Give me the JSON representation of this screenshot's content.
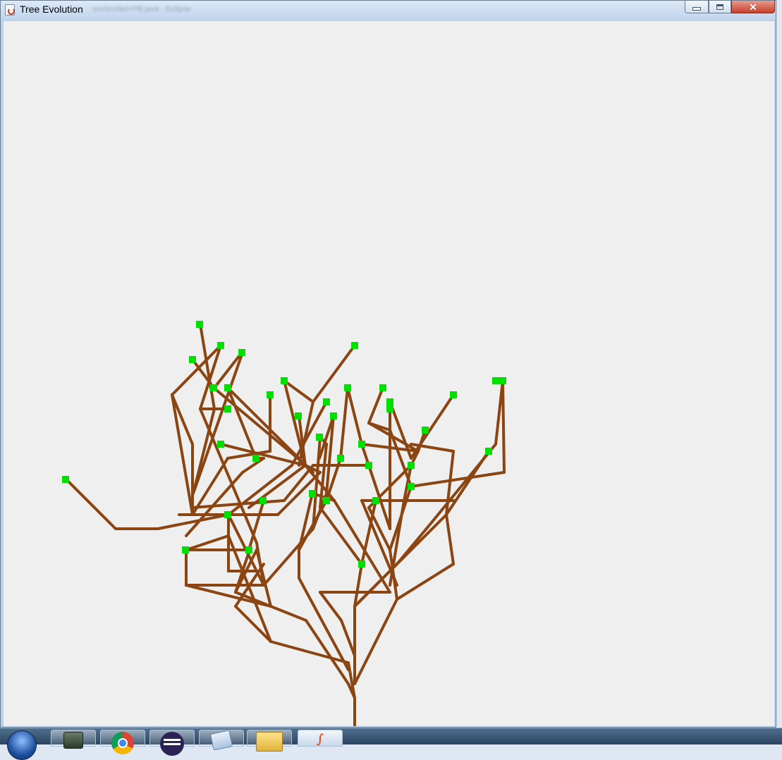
{
  "window": {
    "title": "Tree Evolution",
    "background_title": "src/src/del+PB.java - Eclipse",
    "controls": {
      "minimize": "minimize",
      "maximize": "maximize",
      "close": "✕"
    }
  },
  "colors": {
    "canvas_bg": "#efefef",
    "branch": "#8b4513",
    "leaf": "#00e000"
  },
  "tree": {
    "branches": [
      [
        502,
        1029,
        502,
        989
      ],
      [
        502,
        989,
        493,
        969
      ],
      [
        493,
        969,
        433,
        879
      ],
      [
        433,
        879,
        383,
        859
      ],
      [
        383,
        859,
        333,
        839
      ],
      [
        333,
        839,
        353,
        779
      ],
      [
        502,
        989,
        493,
        939
      ],
      [
        493,
        939,
        383,
        909
      ],
      [
        383,
        909,
        333,
        859
      ],
      [
        333,
        859,
        373,
        799
      ],
      [
        502,
        969,
        562,
        849
      ],
      [
        562,
        849,
        552,
        779
      ],
      [
        552,
        779,
        582,
        689
      ],
      [
        562,
        849,
        642,
        799
      ],
      [
        642,
        799,
        632,
        729
      ],
      [
        632,
        729,
        692,
        639
      ],
      [
        632,
        729,
        642,
        639
      ],
      [
        642,
        639,
        582,
        629
      ],
      [
        502,
        969,
        502,
        859
      ],
      [
        502,
        859,
        562,
        799
      ],
      [
        562,
        799,
        612,
        739
      ],
      [
        612,
        739,
        702,
        629
      ],
      [
        702,
        629,
        712,
        539
      ],
      [
        712,
        539,
        714,
        669
      ],
      [
        714,
        669,
        582,
        689
      ],
      [
        502,
        859,
        512,
        799
      ],
      [
        512,
        799,
        532,
        709
      ],
      [
        502,
        929,
        483,
        879
      ],
      [
        483,
        879,
        453,
        839
      ],
      [
        453,
        839,
        552,
        839
      ],
      [
        552,
        839,
        473,
        709
      ],
      [
        473,
        709,
        443,
        699
      ],
      [
        493,
        949,
        423,
        819
      ],
      [
        423,
        819,
        423,
        779
      ],
      [
        423,
        779,
        462,
        709
      ],
      [
        462,
        709,
        482,
        649
      ],
      [
        482,
        649,
        492,
        549
      ],
      [
        423,
        779,
        442,
        699
      ],
      [
        383,
        859,
        263,
        829
      ],
      [
        263,
        829,
        263,
        779
      ],
      [
        263,
        779,
        352,
        779
      ],
      [
        352,
        779,
        373,
        709
      ],
      [
        263,
        829,
        373,
        829
      ],
      [
        373,
        829,
        323,
        729
      ],
      [
        323,
        729,
        323,
        809
      ],
      [
        323,
        809,
        363,
        809
      ],
      [
        373,
        829,
        443,
        749
      ],
      [
        443,
        749,
        462,
        699
      ],
      [
        462,
        699,
        472,
        589
      ],
      [
        443,
        749,
        453,
        619
      ],
      [
        333,
        839,
        363,
        779
      ],
      [
        363,
        779,
        383,
        859
      ],
      [
        383,
        909,
        323,
        759
      ],
      [
        323,
        759,
        263,
        779
      ],
      [
        373,
        829,
        363,
        769
      ],
      [
        363,
        769,
        283,
        579
      ],
      [
        283,
        579,
        323,
        579
      ],
      [
        283,
        579,
        312,
        489
      ],
      [
        243,
        559,
        272,
        629
      ],
      [
        272,
        629,
        272,
        729
      ],
      [
        272,
        729,
        243,
        559
      ],
      [
        243,
        559,
        312,
        489
      ],
      [
        272,
        729,
        322,
        649
      ],
      [
        322,
        649,
        382,
        639
      ],
      [
        382,
        639,
        382,
        559
      ],
      [
        272,
        719,
        402,
        709
      ],
      [
        402,
        709,
        443,
        659
      ],
      [
        443,
        659,
        522,
        659
      ],
      [
        253,
        729,
        393,
        729
      ],
      [
        393,
        729,
        453,
        669
      ],
      [
        453,
        669,
        432,
        659
      ],
      [
        432,
        659,
        402,
        539
      ],
      [
        223,
        749,
        163,
        749
      ],
      [
        163,
        749,
        93,
        679
      ],
      [
        223,
        749,
        323,
        729
      ],
      [
        323,
        729,
        413,
        659
      ],
      [
        413,
        659,
        462,
        569
      ],
      [
        263,
        759,
        343,
        669
      ],
      [
        343,
        669,
        373,
        649
      ],
      [
        373,
        649,
        362,
        649
      ],
      [
        432,
        659,
        312,
        629
      ],
      [
        432,
        659,
        352,
        719
      ],
      [
        433,
        659,
        302,
        549
      ],
      [
        302,
        549,
        272,
        509
      ],
      [
        443,
        669,
        322,
        549
      ],
      [
        473,
        709,
        432,
        659
      ],
      [
        432,
        659,
        423,
        589
      ],
      [
        423,
        659,
        443,
        569
      ],
      [
        443,
        569,
        502,
        489
      ],
      [
        443,
        569,
        402,
        539
      ],
      [
        512,
        799,
        453,
        719
      ],
      [
        453,
        719,
        462,
        629
      ],
      [
        462,
        629,
        453,
        619
      ],
      [
        552,
        779,
        522,
        719
      ],
      [
        522,
        719,
        582,
        659
      ],
      [
        582,
        659,
        592,
        639
      ],
      [
        592,
        639,
        602,
        609
      ],
      [
        582,
        689,
        552,
        609
      ],
      [
        552,
        609,
        522,
        599
      ],
      [
        522,
        599,
        542,
        549
      ],
      [
        562,
        829,
        512,
        709
      ],
      [
        512,
        709,
        582,
        709
      ],
      [
        582,
        709,
        642,
        709
      ],
      [
        552,
        829,
        572,
        709
      ],
      [
        572,
        709,
        582,
        659
      ],
      [
        552,
        749,
        512,
        629
      ],
      [
        512,
        629,
        492,
        549
      ],
      [
        552,
        749,
        552,
        569
      ],
      [
        552,
        569,
        582,
        649
      ],
      [
        582,
        649,
        642,
        559
      ],
      [
        502,
        859,
        632,
        729
      ],
      [
        512,
        629,
        592,
        639
      ],
      [
        592,
        639,
        522,
        599
      ],
      [
        283,
        459,
        303,
        579
      ],
      [
        303,
        579,
        273,
        699
      ],
      [
        273,
        699,
        343,
        499
      ],
      [
        342,
        499,
        303,
        549
      ],
      [
        322,
        549,
        362,
        649
      ],
      [
        452,
        649,
        472,
        589
      ]
    ],
    "leaves": [
      [
        282,
        459
      ],
      [
        312,
        489
      ],
      [
        342,
        499
      ],
      [
        272,
        509
      ],
      [
        502,
        489
      ],
      [
        302,
        549
      ],
      [
        322,
        549
      ],
      [
        402,
        539
      ],
      [
        382,
        559
      ],
      [
        322,
        579
      ],
      [
        492,
        549
      ],
      [
        542,
        549
      ],
      [
        552,
        569
      ],
      [
        552,
        579
      ],
      [
        462,
        569
      ],
      [
        472,
        589
      ],
      [
        422,
        589
      ],
      [
        642,
        559
      ],
      [
        702,
        539
      ],
      [
        712,
        539
      ],
      [
        602,
        609
      ],
      [
        452,
        619
      ],
      [
        312,
        629
      ],
      [
        512,
        629
      ],
      [
        692,
        639
      ],
      [
        482,
        649
      ],
      [
        362,
        649
      ],
      [
        522,
        659
      ],
      [
        582,
        659
      ],
      [
        92,
        679
      ],
      [
        582,
        689
      ],
      [
        442,
        699
      ],
      [
        372,
        709
      ],
      [
        462,
        709
      ],
      [
        532,
        709
      ],
      [
        322,
        729
      ],
      [
        262,
        779
      ],
      [
        352,
        779
      ],
      [
        512,
        799
      ]
    ]
  },
  "taskbar": {
    "items": [
      "start",
      "terminal",
      "chrome",
      "eclipse",
      "notepad",
      "folder",
      "java"
    ]
  }
}
